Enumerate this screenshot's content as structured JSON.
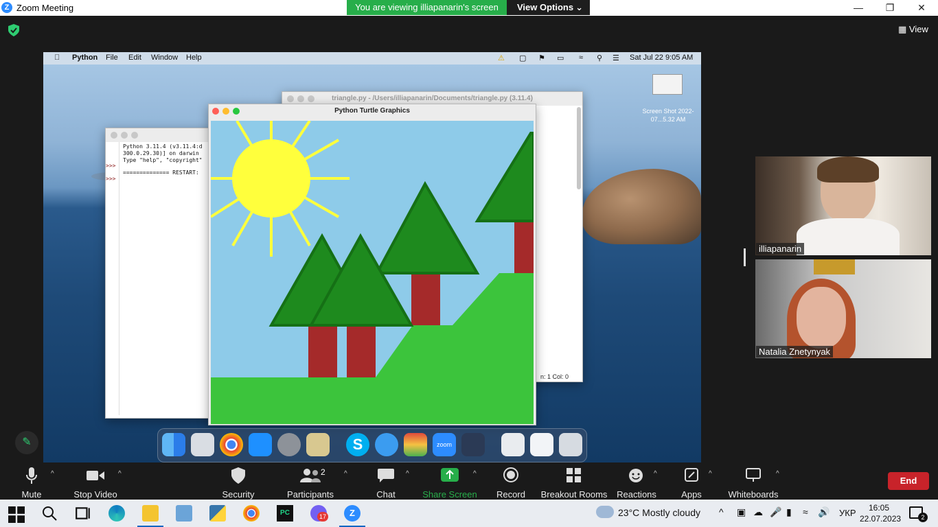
{
  "window": {
    "title": "Zoom Meeting"
  },
  "banner": {
    "viewing": "You are viewing illiapanarin's screen",
    "view_options": "View Options"
  },
  "top_right": {
    "view": "View"
  },
  "mac": {
    "menu": [
      "Python",
      "File",
      "Edit",
      "Window",
      "Help"
    ],
    "clock": "Sat Jul 22  9:05 AM",
    "editor_title": "triangle.py - /Users/illiapanarin/Documents/triangle.py (3.11.4)",
    "editor_status": "n: 1   Col: 0",
    "turtle_title": "Python Turtle Graphics",
    "shell_lines": [
      "Python 3.11.4 (v3.11.4:d",
      "300.0.29.30)] on darwin",
      "Type \"help\", \"copyright\""
    ],
    "shell_prompt": ">>>",
    "shell_restart": "============== RESTART:",
    "desktop_file": "Screen Shot 2022-07...5.32 AM"
  },
  "participants_video": [
    {
      "name": "illiapanarin"
    },
    {
      "name": "Natalia Znetynyak"
    }
  ],
  "toolbar": {
    "mute": "Mute",
    "stop_video": "Stop Video",
    "security": "Security",
    "participants": "Participants",
    "participants_count": "2",
    "chat": "Chat",
    "share_screen": "Share Screen",
    "record": "Record",
    "breakout": "Breakout Rooms",
    "reactions": "Reactions",
    "apps": "Apps",
    "whiteboards": "Whiteboards",
    "end": "End"
  },
  "taskbar": {
    "weather": "23°C  Mostly cloudy",
    "lang": "УКР",
    "time": "16:05",
    "date": "22.07.2023",
    "viber_badge": "17",
    "notif_count": "2"
  },
  "colors": {
    "zoom_blue": "#2d8cff",
    "share_green": "#27ae4a",
    "end_red": "#c8232a"
  }
}
